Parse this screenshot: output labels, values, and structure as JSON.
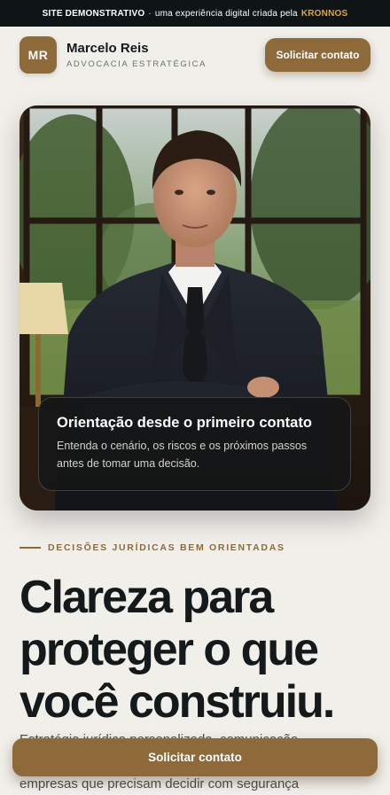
{
  "banner": {
    "label": "SITE DEMONSTRATIVO",
    "separator": "·",
    "text": "uma experiência digital criada pela",
    "brand": "KRONNOS"
  },
  "header": {
    "initials": "MR",
    "name": "Marcelo Reis",
    "subtitle": "ADVOCACIA ESTRATÉGICA",
    "cta_label": "Solicitar contato"
  },
  "hero": {
    "caption_title": "Orientação desde o primeiro contato",
    "caption_text": "Entenda o cenário, os riscos e os próximos passos antes de tomar uma decisão."
  },
  "intro": {
    "eyebrow": "DECISÕES JURÍDICAS BEM ORIENTADAS",
    "headline": "Clareza para proteger o que você construiu.",
    "body_line1": "Estratégia jurídica personalizada, comunicação",
    "body_line3": "empresas que precisam decidir com segurança"
  },
  "sticky": {
    "cta_label": "Solicitar contato"
  },
  "colors": {
    "accent": "#8e6a3a",
    "brand_highlight": "#e0a23c",
    "background": "#f1efea",
    "text_dark": "#14191b"
  }
}
